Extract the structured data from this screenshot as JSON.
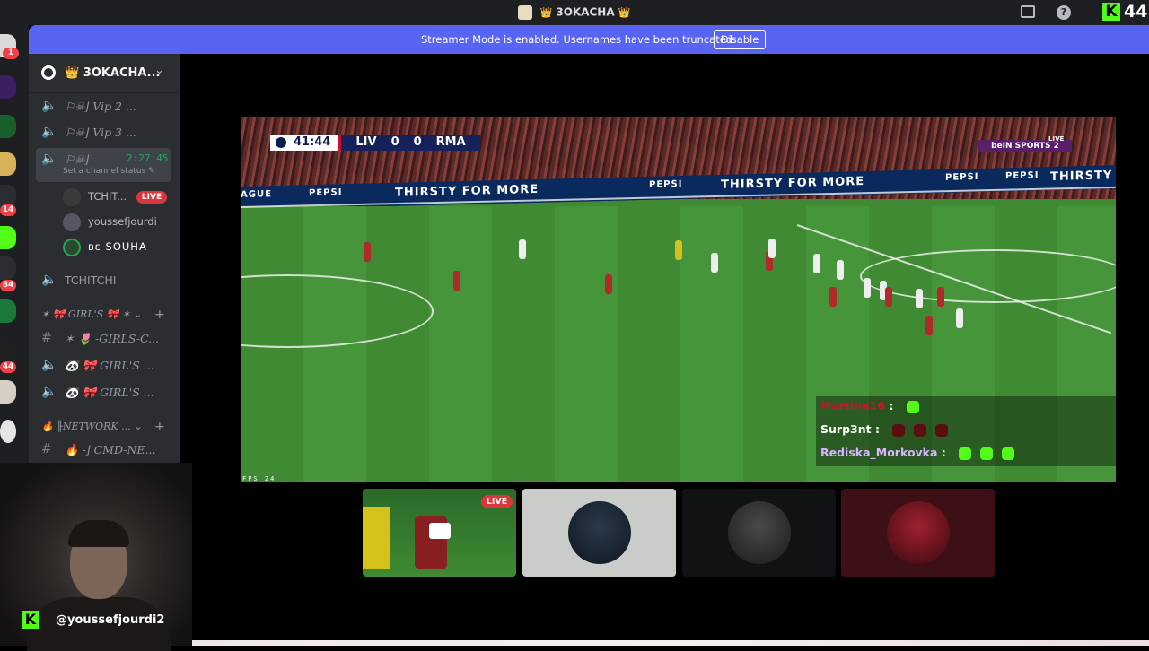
{
  "topbar": {
    "server_title": "3OKACHA",
    "crown_left": "👑",
    "crown_right": "👑",
    "kick_count": "44",
    "kick_letter": "K",
    "help": "?"
  },
  "banner": {
    "message": "Streamer Mode is enabled. Usernames have been truncated.",
    "button": "Disable"
  },
  "guild_rail": {
    "badges": [
      "1",
      "14",
      "84",
      "44"
    ]
  },
  "sidebar": {
    "server_name": "👑 3OKACHA...",
    "channels": [
      {
        "label": "Vip 2 ...",
        "prefix": "⚐☠⌋"
      },
      {
        "label": "Vip 3 ...",
        "prefix": "⚐☠⌋"
      },
      {
        "label": "",
        "prefix": "⚐☠⌋",
        "time": "2:27:45",
        "status": "Set a channel status ✎"
      }
    ],
    "voice_users": [
      {
        "name": "TCHIT...",
        "live": "LIVE"
      },
      {
        "name": "youssefjourdi"
      },
      {
        "name": "ʙɛ SOUHA"
      }
    ],
    "tchitchi_channel": "TCHITCHI",
    "category_girls": "✶ 🎀 GIRL'S 🎀 ✶ ⌄",
    "girls_channels": [
      "✶ 🌷 -GIRLS-C...",
      "🐼 🎀 GIRL'S ...",
      "🐼 🎀 GIRL'S ..."
    ],
    "category_network": "🔥 ╟NETWORK ... ⌄",
    "network_channels": [
      "🔥 -⌋ CMD-NE..."
    ]
  },
  "stream": {
    "clock": "41:44",
    "home": "LIV",
    "home_score": "0",
    "away_score": "0",
    "away": "RMA",
    "broadcaster": "beIN SPORTS 2",
    "live_tag": "LIVE",
    "ad_texts": [
      "AGUE",
      "PEPSI",
      "THIRSTY FOR MORE",
      "PEPSI",
      "THIRSTY FOR MORE",
      "PEPSI",
      "PEPSI",
      "THIRSTY FC"
    ],
    "fps": "FPS 24"
  },
  "chat_overlay": [
    {
      "user": "Martine16",
      "sep": ":",
      "color": "#c0182a",
      "emotes": 1,
      "emote_color": "#53fc18"
    },
    {
      "user": "Surp3nt",
      "sep": ":",
      "color": "#ffffff",
      "emotes": 3,
      "emote_color": "#5a0e10"
    },
    {
      "user": "Rediska_Morkovka",
      "sep": ":",
      "color": "#d9b3ff",
      "emotes": 3,
      "emote_color": "#53fc18"
    }
  ],
  "tiles": {
    "live_label": "LIVE"
  },
  "webcam": {
    "handle": "@youssefjourdi2",
    "kick_letter": "K"
  }
}
